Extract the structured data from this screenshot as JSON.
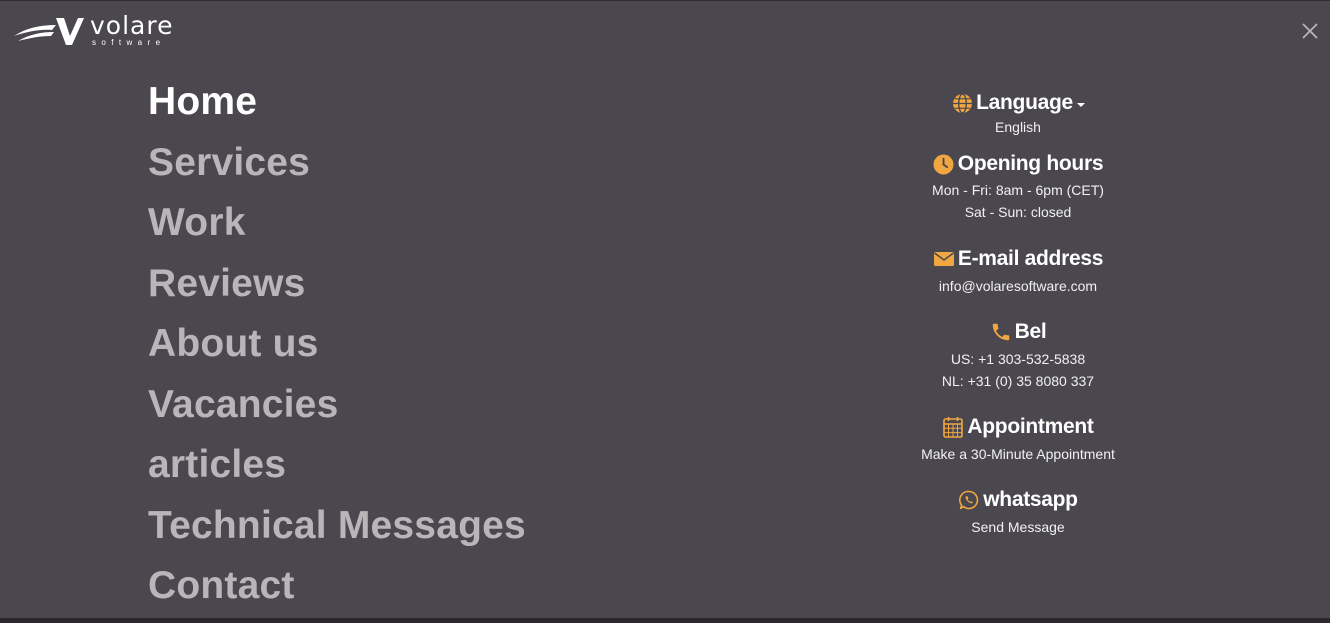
{
  "brand": {
    "name": "volare",
    "tagline": "software"
  },
  "nav": {
    "items": [
      {
        "label": "Home",
        "active": true
      },
      {
        "label": "Services",
        "active": false
      },
      {
        "label": "Work",
        "active": false
      },
      {
        "label": "Reviews",
        "active": false
      },
      {
        "label": "About us",
        "active": false
      },
      {
        "label": "Vacancies",
        "active": false
      },
      {
        "label": "articles",
        "active": false
      },
      {
        "label": "Technical Messages",
        "active": false
      },
      {
        "label": "Contact",
        "active": false
      }
    ]
  },
  "info": {
    "language": {
      "title": "Language",
      "value": "English",
      "icon": "globe-icon"
    },
    "hours": {
      "title": "Opening hours",
      "weekdays": "Mon - Fri: 8am - 6pm (CET)",
      "weekend": "Sat - Sun: closed",
      "icon": "clock-icon"
    },
    "email": {
      "title": "E-mail address",
      "value": "info@volaresoftware.com",
      "icon": "envelope-icon"
    },
    "phone": {
      "title": "Bel",
      "us": "US: +1 303-532-5838",
      "nl": "NL: +31 (0) 35 8080 337",
      "icon": "phone-icon"
    },
    "appointment": {
      "title": "Appointment",
      "value": "Make a 30-Minute Appointment",
      "icon": "calendar-icon"
    },
    "whatsapp": {
      "title": "whatsapp",
      "value": "Send Message",
      "icon": "whatsapp-icon"
    }
  },
  "colors": {
    "background": "#4a474e",
    "accent": "#f0a742",
    "nav_inactive": "#b8b6b9",
    "nav_active": "#ffffff"
  }
}
